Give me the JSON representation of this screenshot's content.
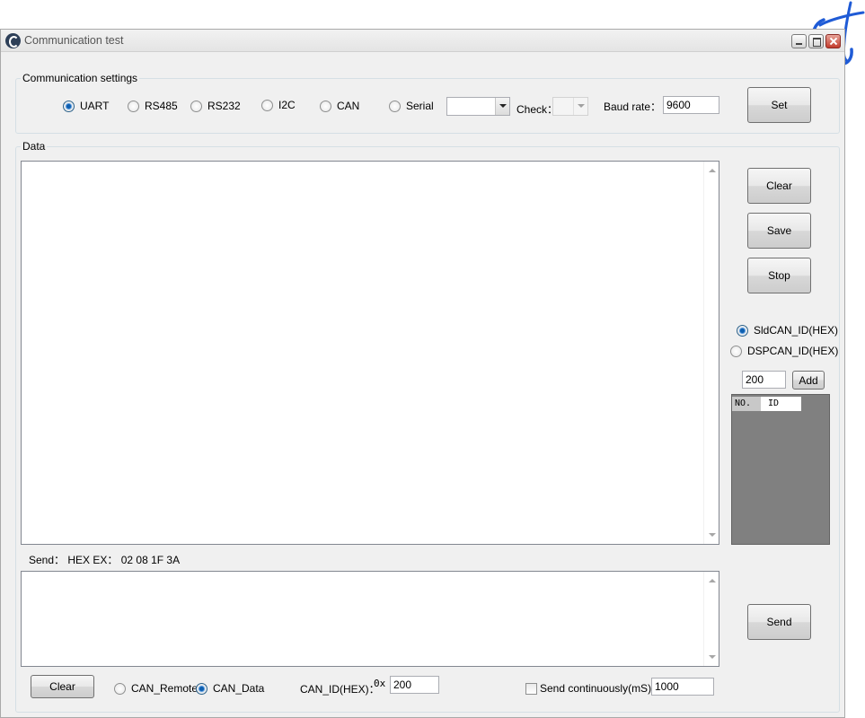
{
  "window": {
    "title": "Communication test",
    "icons": {
      "app": "app-logo-icon",
      "minimize": "minimize-icon",
      "maximize": "maximize-icon",
      "close": "close-icon"
    }
  },
  "settings": {
    "group_label": "Communication settings",
    "protocols": [
      {
        "label": "UART",
        "checked": true
      },
      {
        "label": "RS485",
        "checked": false
      },
      {
        "label": "RS232",
        "checked": false
      },
      {
        "label": "I2C",
        "checked": false
      },
      {
        "label": "CAN",
        "checked": false
      },
      {
        "label": "Serial",
        "checked": false
      }
    ],
    "serial_port_value": "",
    "check_label": "Check：",
    "check_value": "",
    "baud_label": "Baud rate：",
    "baud_value": "9600",
    "set_button": "Set"
  },
  "data": {
    "group_label": "Data",
    "received_text": "",
    "clear_button": "Clear",
    "save_button": "Save",
    "stop_button": "Stop"
  },
  "can_id_panel": {
    "options": [
      {
        "label": "SldCAN_ID(HEX)",
        "checked": true
      },
      {
        "label": "DSPCAN_ID(HEX)",
        "checked": false
      }
    ],
    "id_input_value": "200",
    "add_button": "Add",
    "list_columns": [
      "NO.",
      "ID"
    ]
  },
  "send": {
    "hint": "Send： HEX  EX： 02 08 1F 3A",
    "text": "",
    "send_button": "Send",
    "clear_button": "Clear",
    "frame_types": [
      {
        "label": "CAN_Remote",
        "checked": false
      },
      {
        "label": "CAN_Data",
        "checked": true
      }
    ],
    "can_id_label": "CAN_ID(HEX)：",
    "hex_prefix": "0x",
    "can_id_value": "200",
    "continuous_label": "Send continuously(mS)",
    "continuous_checked": false,
    "interval_value": "1000"
  },
  "colors": {
    "window_bg": "#f0f0f0",
    "list_bg": "#808080",
    "radio_checked": "#0e5fb0",
    "annotation_ink": "#1f5bd6"
  }
}
